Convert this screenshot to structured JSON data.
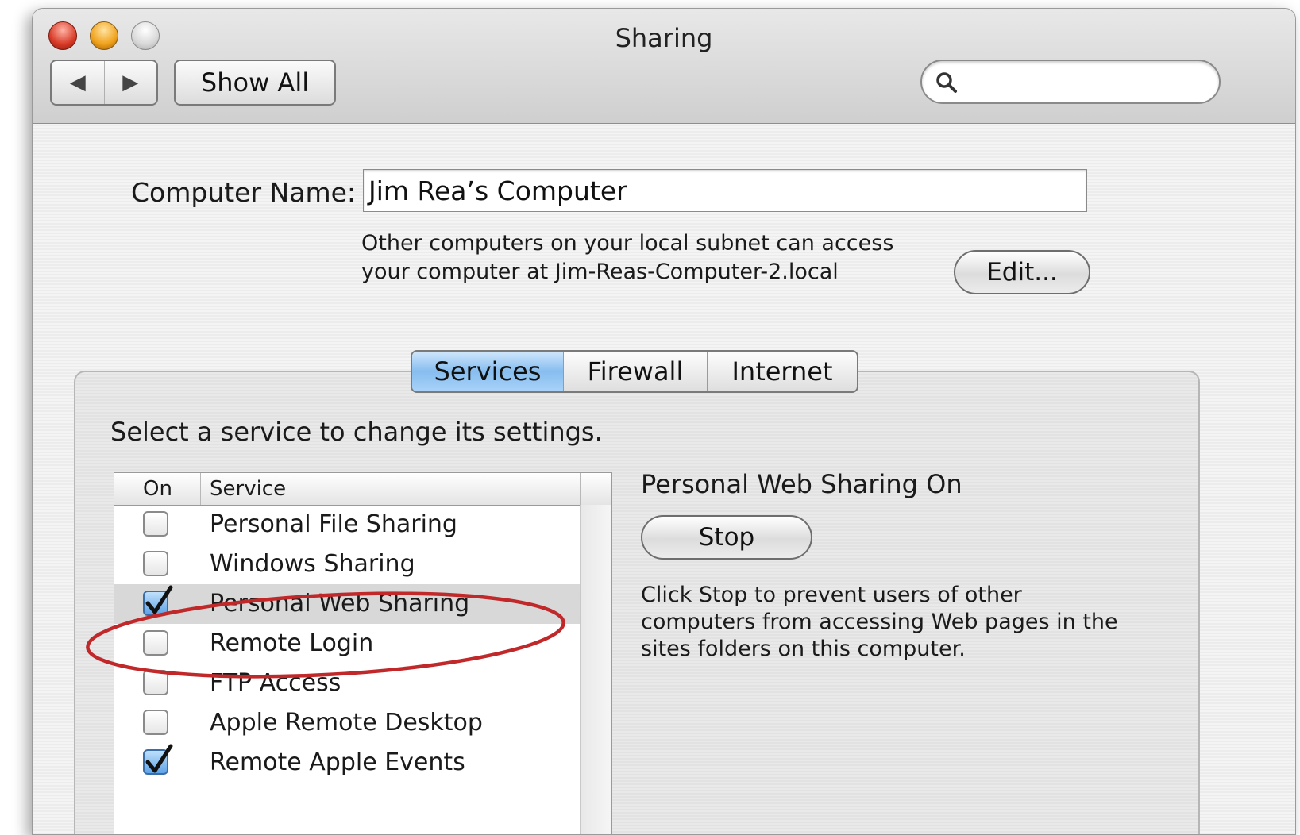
{
  "window": {
    "title": "Sharing",
    "nav_back_glyph": "◀",
    "nav_forward_glyph": "▶",
    "show_all_label": "Show All",
    "search": {
      "placeholder": "",
      "value": ""
    }
  },
  "computer_name": {
    "label": "Computer Name:",
    "value": "Jim Rea’s Computer",
    "info_line1": "Other computers on your local subnet can access",
    "info_line2": "your computer at Jim-Reas-Computer-2.local",
    "edit_label": "Edit..."
  },
  "tabs": [
    {
      "label": "Services",
      "selected": true
    },
    {
      "label": "Firewall",
      "selected": false
    },
    {
      "label": "Internet",
      "selected": false
    }
  ],
  "services_panel": {
    "instruction": "Select a service to change its settings.",
    "columns": {
      "on": "On",
      "service": "Service"
    },
    "rows": [
      {
        "label": "Personal File Sharing",
        "checked": false,
        "selected": false
      },
      {
        "label": "Windows Sharing",
        "checked": false,
        "selected": false
      },
      {
        "label": "Personal Web Sharing",
        "checked": true,
        "selected": true
      },
      {
        "label": "Remote Login",
        "checked": false,
        "selected": false
      },
      {
        "label": "FTP Access",
        "checked": false,
        "selected": false
      },
      {
        "label": "Apple Remote Desktop",
        "checked": false,
        "selected": false
      },
      {
        "label": "Remote Apple Events",
        "checked": true,
        "selected": false
      }
    ],
    "status_title": "Personal Web Sharing On",
    "stop_label": "Stop",
    "description_line1": "Click Stop to prevent users of other",
    "description_line2": "computers from accessing Web pages in the",
    "description_line3": "sites folders on this computer."
  },
  "colors": {
    "selected_tab": "#86bdf0",
    "checkbox_checked": "#5fa3e8",
    "selected_row": "#d8d8d8",
    "annotation_ellipse": "#c0282a"
  },
  "annotation": {
    "shape": "ellipse",
    "target": "Personal Web Sharing"
  }
}
